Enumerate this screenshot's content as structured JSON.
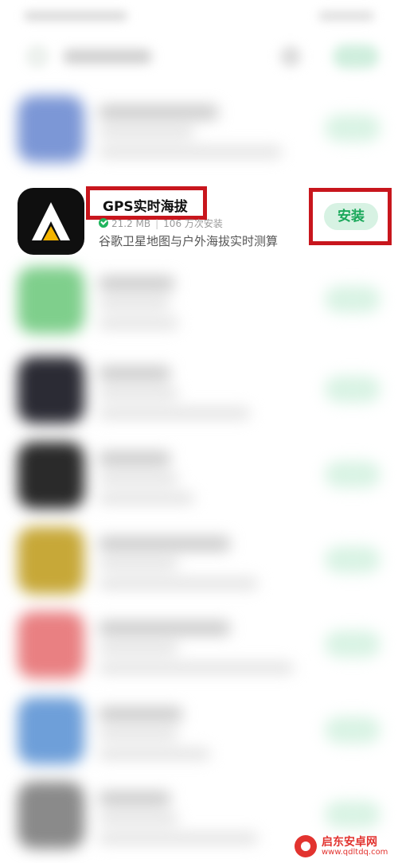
{
  "colors": {
    "install_green": "#1aa85a",
    "install_bg": "#d7f2e3",
    "highlight_red": "#c8161d",
    "verified_green": "#1fb55d"
  },
  "featured_app": {
    "name": "GPS实时海拔",
    "size": "21.2 MB",
    "installs": "106 万次安装",
    "description": "谷歌卫星地图与户外海拔实时测算",
    "install_label": "安装",
    "icon": "mountain-peak-icon",
    "badge_icon": "verified-check-icon"
  },
  "watermark": {
    "name": "启东安卓网",
    "url": "www.qdltdq.com"
  }
}
